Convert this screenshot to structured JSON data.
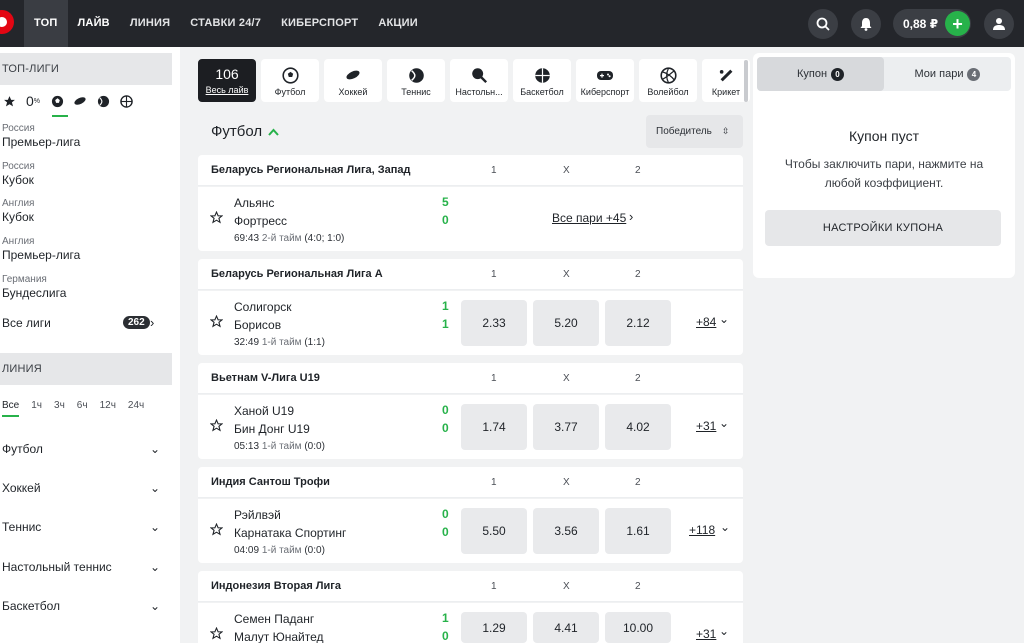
{
  "nav": {
    "items": [
      "ТОП",
      "ЛАЙВ",
      "ЛИНИЯ",
      "СТАВКИ 24/7",
      "КИБЕРСПОРТ",
      "АКЦИИ"
    ],
    "balance": "0,88 ₽"
  },
  "sidebar": {
    "top_header": "ТОП-ЛИГИ",
    "zero_label": "0",
    "leagues": [
      {
        "country": "Россия",
        "name": "Премьер-лига"
      },
      {
        "country": "Россия",
        "name": "Кубок"
      },
      {
        "country": "Англия",
        "name": "Кубок"
      },
      {
        "country": "Англия",
        "name": "Премьер-лига"
      },
      {
        "country": "Германия",
        "name": "Бундеслига"
      }
    ],
    "all_leagues": "Все лиги",
    "all_leagues_count": "262",
    "line_header": "ЛИНИЯ",
    "time_filters": [
      "Все",
      "1ч",
      "3ч",
      "6ч",
      "12ч",
      "24ч"
    ],
    "sports": [
      "Футбол",
      "Хоккей",
      "Теннис",
      "Настольный теннис",
      "Баскетбол"
    ]
  },
  "tabs": {
    "live_count": "106",
    "live_label": "Весь лайв",
    "sports": [
      "Футбол",
      "Хоккей",
      "Теннис",
      "Настольн...",
      "Баскетбол",
      "Киберспорт",
      "Волейбол",
      "Крикет"
    ]
  },
  "main": {
    "title": "Футбол",
    "winner": "Победитель",
    "col1": "1",
    "colx": "X",
    "col2": "2",
    "leagues": [
      {
        "name": "Беларусь Региональная Лига, Запад",
        "team1": "Альянс",
        "team2": "Фортресс",
        "score1": "5",
        "score2": "0",
        "time": "69:43",
        "half": "2-й тайм",
        "partial": "(4:0; 1:0)",
        "all_bets": "Все пари +45"
      },
      {
        "name": "Беларусь Региональная Лига А",
        "team1": "Солигорск",
        "team2": "Борисов",
        "score1": "1",
        "score2": "1",
        "time": "32:49",
        "half": "1-й тайм",
        "partial": "(1:1)",
        "odds": [
          "2.33",
          "5.20",
          "2.12"
        ],
        "more": "+84"
      },
      {
        "name": "Вьетнам V-Лига U19",
        "team1": "Ханой U19",
        "team2": "Бин Донг U19",
        "score1": "0",
        "score2": "0",
        "time": "05:13",
        "half": "1-й тайм",
        "partial": "(0:0)",
        "odds": [
          "1.74",
          "3.77",
          "4.02"
        ],
        "more": "+31"
      },
      {
        "name": "Индия Сантош Трофи",
        "team1": "Рэйлвэй",
        "team2": "Карнатака Спортинг",
        "score1": "0",
        "score2": "0",
        "time": "04:09",
        "half": "1-й тайм",
        "partial": "(0:0)",
        "odds": [
          "5.50",
          "3.56",
          "1.61"
        ],
        "more": "+118"
      },
      {
        "name": "Индонезия Вторая Лига",
        "team1": "Семен Паданг",
        "team2": "Малут Юнайтед",
        "score1": "1",
        "score2": "0",
        "odds": [
          "1.29",
          "4.41",
          "10.00"
        ],
        "more": "+31"
      }
    ]
  },
  "coupon": {
    "tab1": "Купон",
    "tab1_count": "0",
    "tab2": "Мои пари",
    "tab2_count": "4",
    "empty_title": "Купон пуст",
    "empty_desc": "Чтобы заключить пари, нажмите на любой коэффициент.",
    "settings_btn": "НАСТРОЙКИ КУПОНА"
  },
  "colors": {
    "accent_green": "#27b24a",
    "nav_bg": "#24262b",
    "logo_red": "#e30613"
  }
}
